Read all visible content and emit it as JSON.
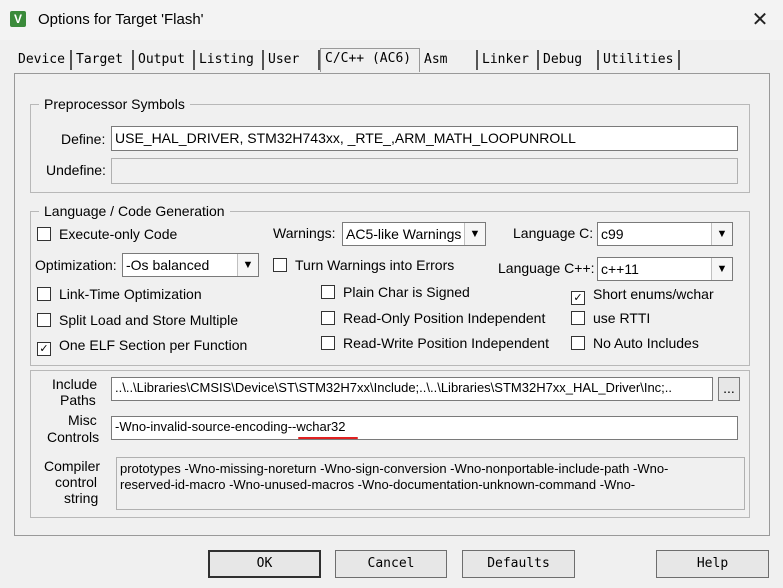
{
  "window": {
    "title": "Options for Target 'Flash'",
    "icon_text": "V",
    "close_glyph": "✕"
  },
  "tabs": [
    {
      "label": "Device"
    },
    {
      "label": "Target"
    },
    {
      "label": "Output"
    },
    {
      "label": "Listing"
    },
    {
      "label": "User"
    },
    {
      "label": "C/C++ (AC6)",
      "active": true
    },
    {
      "label": "Asm"
    },
    {
      "label": "Linker"
    },
    {
      "label": "Debug"
    },
    {
      "label": "Utilities"
    }
  ],
  "preprocessor": {
    "legend": "Preprocessor Symbols",
    "define_label": "Define:",
    "define_value": "USE_HAL_DRIVER, STM32H743xx, _RTE_,ARM_MATH_LOOPUNROLL",
    "undefine_label": "Undefine:",
    "undefine_value": ""
  },
  "language": {
    "legend": "Language / Code Generation",
    "execute_only": {
      "label": "Execute-only Code",
      "checked": false
    },
    "warnings_label": "Warnings:",
    "warnings_value": "AC5-like Warnings",
    "language_c_label": "Language C:",
    "language_c_value": "c99",
    "optimization_label": "Optimization:",
    "optimization_value": "-Os balanced",
    "turn_warnings": {
      "label": "Turn Warnings into Errors",
      "checked": false
    },
    "language_cpp_label": "Language C++:",
    "language_cpp_value": "c++11",
    "lto": {
      "label": "Link-Time Optimization",
      "checked": false
    },
    "plain_char": {
      "label": "Plain Char is Signed",
      "checked": false
    },
    "short_enums": {
      "label": "Short enums/wchar",
      "checked": true
    },
    "split_load": {
      "label": "Split Load and Store Multiple",
      "checked": false
    },
    "ro_pi": {
      "label": "Read-Only Position Independent",
      "checked": false
    },
    "rtti": {
      "label": "use RTTI",
      "checked": false
    },
    "one_elf": {
      "label": "One ELF Section per Function",
      "checked": true
    },
    "rw_pi": {
      "label": "Read-Write Position Independent",
      "checked": false
    },
    "no_auto_includes": {
      "label": "No Auto Includes",
      "checked": false
    }
  },
  "paths": {
    "include_label_1": "Include",
    "include_label_2": "Paths",
    "include_value": "..\\..\\Libraries\\CMSIS\\Device\\ST\\STM32H7xx\\Include;..\\..\\Libraries\\STM32H7xx_HAL_Driver\\Inc;..",
    "browse_label": "...",
    "misc_label_1": "Misc",
    "misc_label_2": "Controls",
    "misc_value": "-Wno-invalid-source-encoding--wchar32",
    "compiler_label_1": "Compiler",
    "compiler_label_2": "control",
    "compiler_label_3": "string",
    "compiler_line_1": "prototypes -Wno-missing-noreturn -Wno-sign-conversion -Wno-nonportable-include-path -Wno-",
    "compiler_line_2": "reserved-id-macro -Wno-unused-macros -Wno-documentation-unknown-command -Wno-"
  },
  "buttons": {
    "ok": "OK",
    "cancel": "Cancel",
    "defaults": "Defaults",
    "help": "Help"
  },
  "colors": {
    "annotation_underline": "#e02020",
    "icon_bg": "#3a8a3a"
  }
}
